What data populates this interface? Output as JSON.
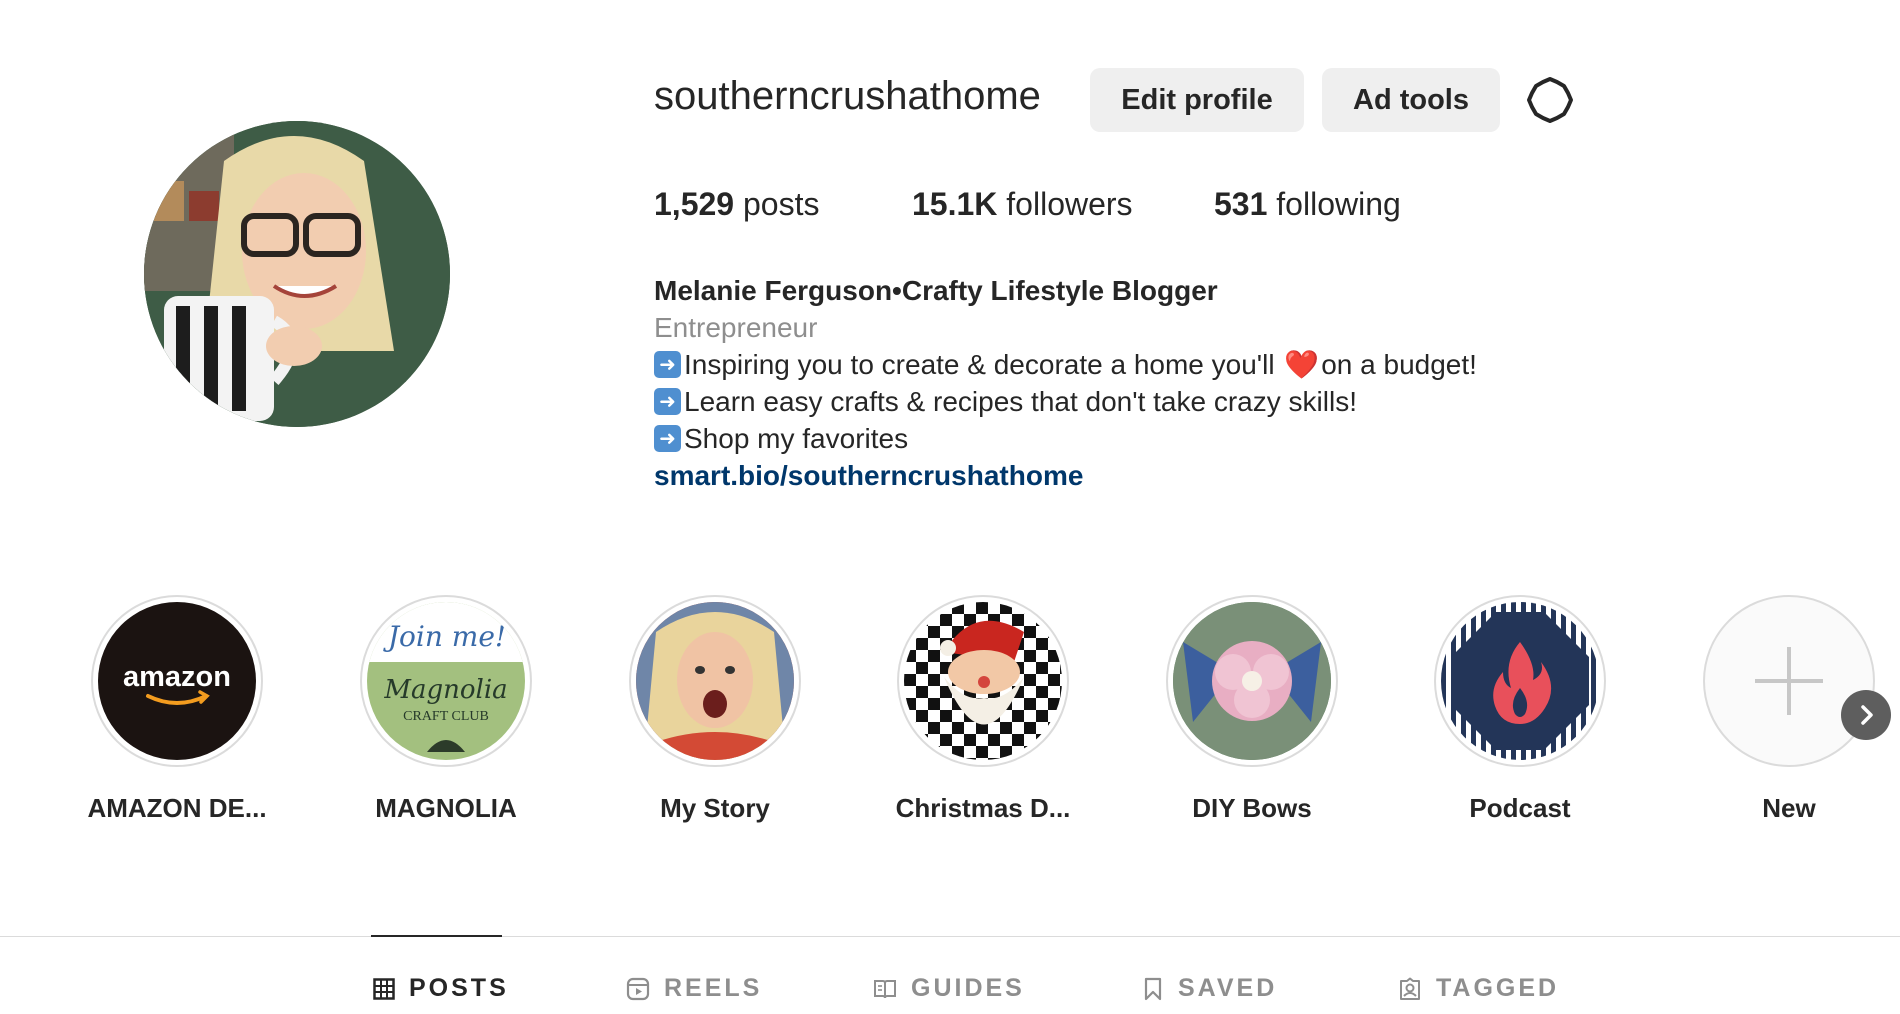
{
  "profile": {
    "username": "southerncrushathome",
    "edit_label": "Edit profile",
    "ad_tools_label": "Ad tools",
    "stats": {
      "posts_count": "1,529",
      "posts_label": "posts",
      "followers_count": "15.1K",
      "followers_label": "followers",
      "following_count": "531",
      "following_label": "following"
    },
    "bio": {
      "name": "Melanie Ferguson•Crafty Lifestyle Blogger",
      "category": "Entrepreneur",
      "line1_a": "Inspiring you to create & decorate a home you'll ",
      "line1_heart": "❤️",
      "line1_b": "on a budget!",
      "line2": "Learn easy crafts & recipes that don't take crazy skills!",
      "line3": "Shop my favorites",
      "link": "smart.bio/southerncrushathome"
    }
  },
  "highlights": [
    {
      "label": "AMAZON DE...",
      "icon": "amazon-logo"
    },
    {
      "label": "MAGNOLIA",
      "icon": "magnolia-craft-club-logo"
    },
    {
      "label": "My Story",
      "icon": "selfie-photo"
    },
    {
      "label": "Christmas D...",
      "icon": "santa-illustration"
    },
    {
      "label": "DIY Bows",
      "icon": "flower-bow-photo"
    },
    {
      "label": "Podcast",
      "icon": "flame-logo"
    },
    {
      "label": "New",
      "icon": "plus-icon"
    }
  ],
  "logo_text": {
    "amazon": "amazon",
    "magnolia_top": "Join me!",
    "magnolia_mid": "Magnolia",
    "magnolia_bottom": "CRAFT CLUB"
  },
  "tabs": [
    {
      "label": "POSTS",
      "active": true
    },
    {
      "label": "REELS",
      "active": false
    },
    {
      "label": "GUIDES",
      "active": false
    },
    {
      "label": "SAVED",
      "active": false
    },
    {
      "label": "TAGGED",
      "active": false
    }
  ],
  "colors": {
    "link": "#00376b",
    "secondary_text": "#8e8e8e",
    "button_bg": "#efefef",
    "podcast_navy": "#233558",
    "podcast_flame": "#e8505b"
  }
}
